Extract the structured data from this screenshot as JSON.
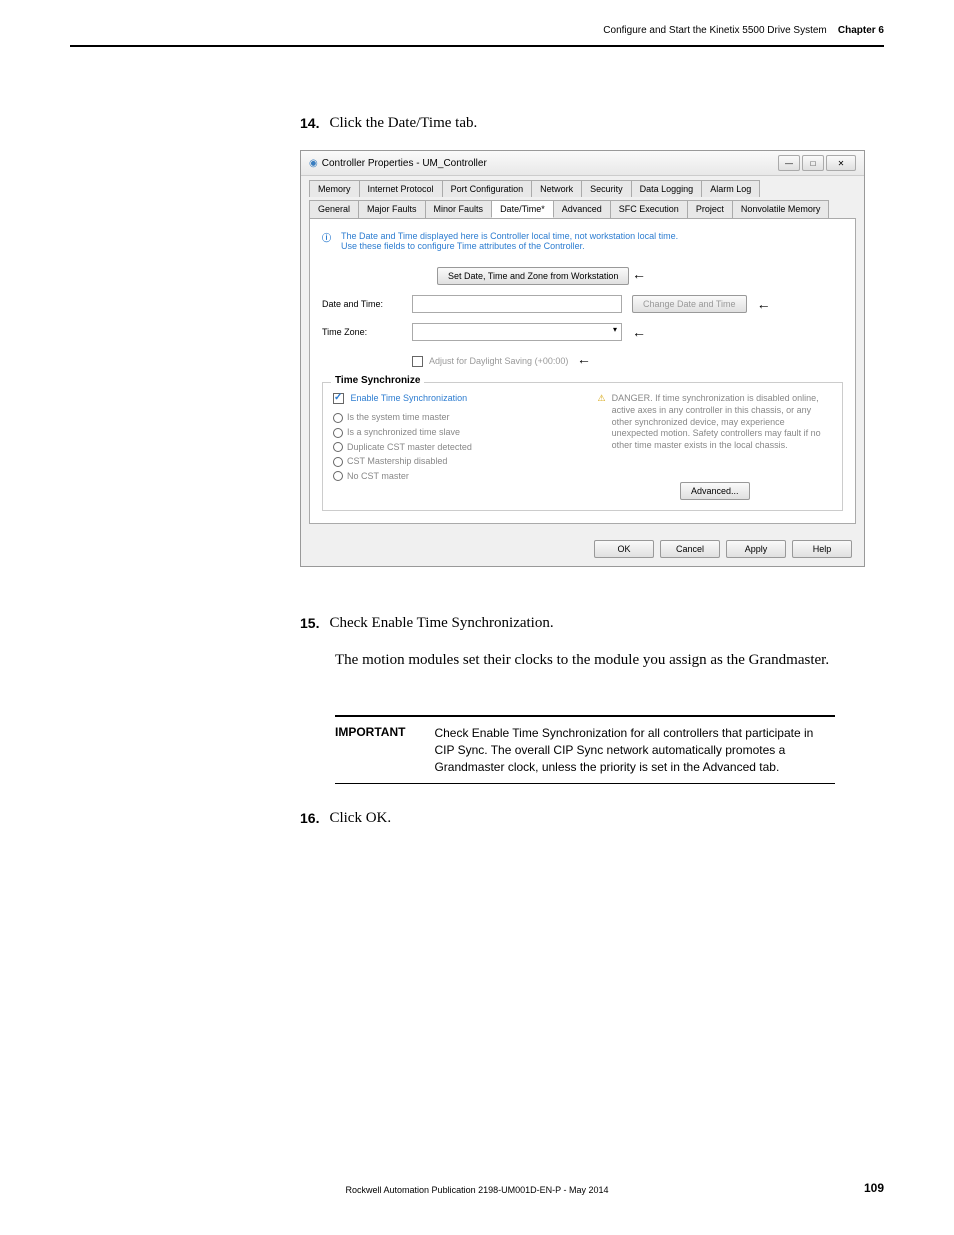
{
  "header": {
    "title": "Configure and Start the Kinetix 5500 Drive System",
    "chapter": "Chapter 6"
  },
  "step14": {
    "num": "14.",
    "text": "Click the Date/Time tab."
  },
  "dialog": {
    "title": "Controller Properties - UM_Controller",
    "tabs_row1": [
      "Memory",
      "Internet Protocol",
      "Port Configuration",
      "Network",
      "Security",
      "Data Logging",
      "Alarm Log"
    ],
    "tabs_row2": [
      "General",
      "Major Faults",
      "Minor Faults",
      "Date/Time*",
      "Advanced",
      "SFC Execution",
      "Project",
      "Nonvolatile Memory"
    ],
    "info_line1": "The Date and Time displayed here is Controller local time, not workstation local time.",
    "info_line2": "Use these fields to configure Time attributes of the Controller.",
    "set_date_btn": "Set Date, Time and Zone from Workstation",
    "date_time_label": "Date and Time:",
    "change_date_btn": "Change Date and Time",
    "time_zone_label": "Time Zone:",
    "daylight_label": "Adjust for Daylight Saving (+00:00)",
    "sync_legend": "Time Synchronize",
    "enable_sync": "Enable Time Synchronization",
    "radio1": "Is the system time master",
    "radio2": "Is a synchronized time slave",
    "radio3": "Duplicate CST master detected",
    "radio4": "CST Mastership disabled",
    "radio5": "No CST master",
    "danger_text": "DANGER. If time synchronization is disabled online, active axes in any controller in this chassis, or any other synchronized device, may experience unexpected motion. Safety controllers may fault if no other time master exists in the local chassis.",
    "advanced_btn": "Advanced...",
    "ok_btn": "OK",
    "cancel_btn": "Cancel",
    "apply_btn": "Apply",
    "help_btn": "Help"
  },
  "step15": {
    "num": "15.",
    "text": "Check Enable Time Synchronization.",
    "body": "The motion modules set their clocks to the module you assign as the Grandmaster."
  },
  "important": {
    "label": "IMPORTANT",
    "text": "Check Enable Time Synchronization for all controllers that participate in CIP Sync. The overall CIP Sync network automatically promotes a Grandmaster clock, unless the priority is set in the Advanced tab."
  },
  "step16": {
    "num": "16.",
    "text": "Click OK."
  },
  "footer": {
    "text": "Rockwell Automation Publication 2198-UM001D-EN-P - May 2014",
    "page": "109"
  }
}
